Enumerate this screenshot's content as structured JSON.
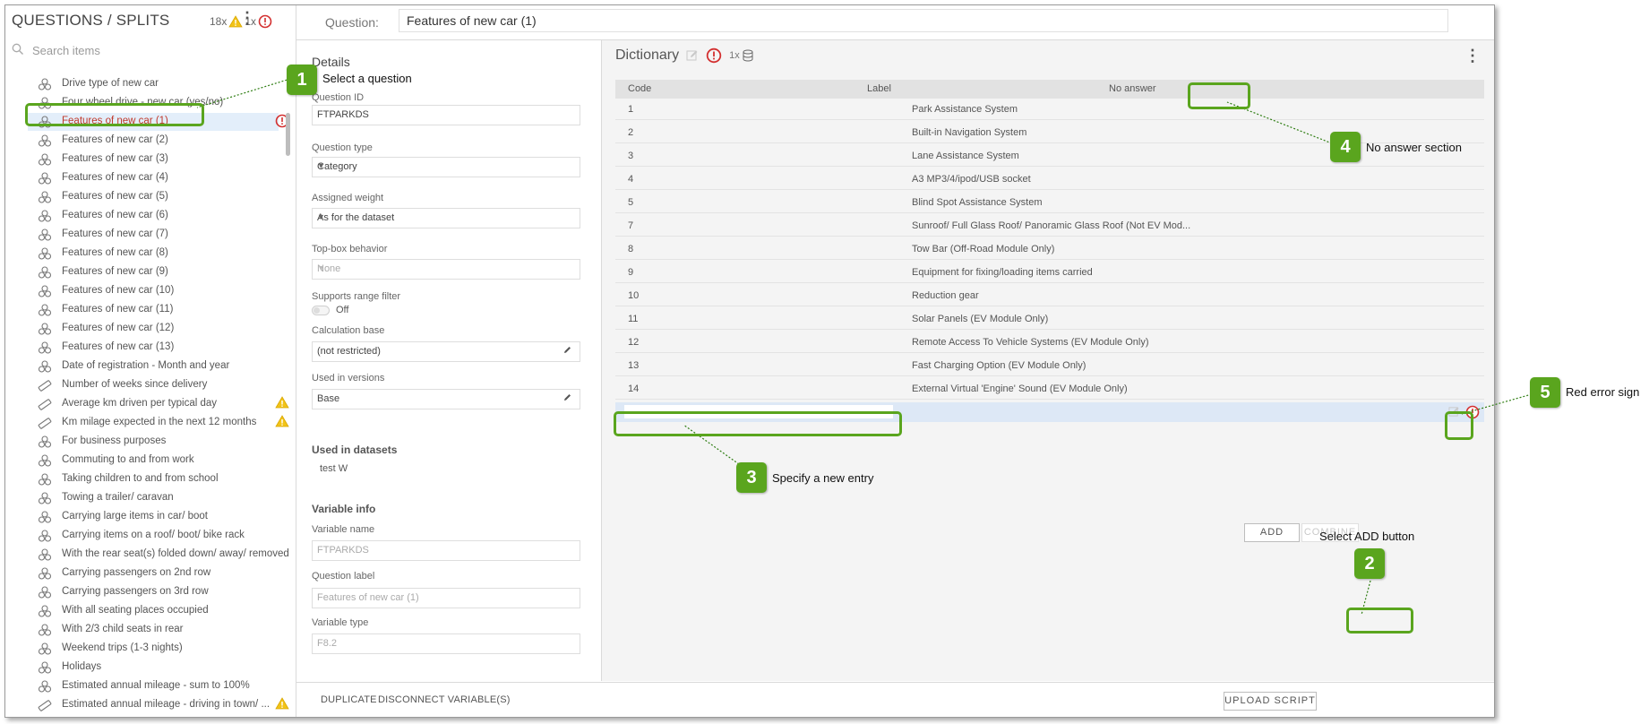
{
  "left_panel": {
    "title": "QUESTIONS / SPLITS",
    "warning_count": "18x",
    "error_count": "1x",
    "search_placeholder": "Search items",
    "items": [
      {
        "label": "Drive type of new car",
        "icon": "category-icon"
      },
      {
        "label": "Four wheel drive - new car (yes/no)",
        "icon": "category-icon"
      },
      {
        "label": "Features of new car (1)",
        "icon": "category-icon",
        "selected": true,
        "error": true
      },
      {
        "label": "Features of new car (2)",
        "icon": "category-icon"
      },
      {
        "label": "Features of new car (3)",
        "icon": "category-icon"
      },
      {
        "label": "Features of new car (4)",
        "icon": "category-icon"
      },
      {
        "label": "Features of new car (5)",
        "icon": "category-icon"
      },
      {
        "label": "Features of new car (6)",
        "icon": "category-icon"
      },
      {
        "label": "Features of new car (7)",
        "icon": "category-icon"
      },
      {
        "label": "Features of new car (8)",
        "icon": "category-icon"
      },
      {
        "label": "Features of new car (9)",
        "icon": "category-icon"
      },
      {
        "label": "Features of new car (10)",
        "icon": "category-icon"
      },
      {
        "label": "Features of new car (11)",
        "icon": "category-icon"
      },
      {
        "label": "Features of new car (12)",
        "icon": "category-icon"
      },
      {
        "label": "Features of new car (13)",
        "icon": "category-icon"
      },
      {
        "label": "Date of registration - Month and year",
        "icon": "category-icon"
      },
      {
        "label": "Number of weeks since delivery",
        "icon": "numeric-icon"
      },
      {
        "label": "Average km driven per typical day",
        "icon": "numeric-icon",
        "warning": true
      },
      {
        "label": "Km milage expected in the next 12 months",
        "icon": "numeric-icon",
        "warning": true
      },
      {
        "label": "For business purposes",
        "icon": "category-icon"
      },
      {
        "label": "Commuting to and from work",
        "icon": "category-icon"
      },
      {
        "label": "Taking children to and from school",
        "icon": "category-icon"
      },
      {
        "label": "Towing a trailer/ caravan",
        "icon": "category-icon"
      },
      {
        "label": "Carrying large items in car/ boot",
        "icon": "category-icon"
      },
      {
        "label": "Carrying items on a roof/ boot/ bike rack",
        "icon": "category-icon"
      },
      {
        "label": "With the rear seat(s) folded down/ away/ removed",
        "icon": "category-icon"
      },
      {
        "label": "Carrying passengers on 2nd row",
        "icon": "category-icon"
      },
      {
        "label": "Carrying passengers on 3rd row",
        "icon": "category-icon"
      },
      {
        "label": "With all seating places occupied",
        "icon": "category-icon"
      },
      {
        "label": "With 2/3 child seats in rear",
        "icon": "category-icon"
      },
      {
        "label": "Weekend trips (1-3 nights)",
        "icon": "category-icon"
      },
      {
        "label": "Holidays",
        "icon": "category-icon"
      },
      {
        "label": "Estimated annual mileage - sum to 100%",
        "icon": "category-icon"
      },
      {
        "label": "Estimated annual mileage - driving in town/ ...",
        "icon": "numeric-icon",
        "warning": true
      }
    ]
  },
  "question_bar": {
    "label": "Question:",
    "value": "Features of new car (1)"
  },
  "details": {
    "title": "Details",
    "question_id_label": "Question ID",
    "question_id_value": "FTPARKDS",
    "question_type_label": "Question type",
    "question_type_value": "Category",
    "assigned_weight_label": "Assigned weight",
    "assigned_weight_value": "As for the dataset",
    "topbox_label": "Top-box behavior",
    "topbox_value": "None",
    "range_filter_label": "Supports range filter",
    "range_filter_value": "Off",
    "calc_base_label": "Calculation base",
    "calc_base_value": "(not restricted)",
    "versions_label": "Used in versions",
    "versions_value": "Base",
    "datasets_title": "Used in datasets",
    "datasets_value": "test W",
    "variable_info_title": "Variable info",
    "variable_name_label": "Variable name",
    "variable_name_value": "FTPARKDS",
    "question_label_label": "Question label",
    "question_label_value": "Features of new car (1)",
    "variable_type_label": "Variable type",
    "variable_type_value": "F8.2"
  },
  "dictionary": {
    "title": "Dictionary",
    "count": "1x",
    "columns": {
      "code": "Code",
      "label": "Label",
      "no_answer": "No answer"
    },
    "rows": [
      {
        "code": "1",
        "label": "Park Assistance System"
      },
      {
        "code": "2",
        "label": "Built-in Navigation System"
      },
      {
        "code": "3",
        "label": "Lane Assistance System"
      },
      {
        "code": "4",
        "label": "A3 MP3/4/ipod/USB socket"
      },
      {
        "code": "5",
        "label": "Blind Spot Assistance System"
      },
      {
        "code": "7",
        "label": "Sunroof/ Full Glass Roof/ Panoramic Glass Roof (Not EV Mod..."
      },
      {
        "code": "8",
        "label": "Tow Bar (Off-Road Module Only)"
      },
      {
        "code": "9",
        "label": "Equipment for fixing/loading items carried"
      },
      {
        "code": "10",
        "label": "Reduction gear"
      },
      {
        "code": "11",
        "label": "Solar Panels (EV Module Only)"
      },
      {
        "code": "12",
        "label": "Remote Access To Vehicle Systems (EV Module Only)"
      },
      {
        "code": "13",
        "label": "Fast Charging Option (EV Module Only)"
      },
      {
        "code": "14",
        "label": "External Virtual 'Engine' Sound (EV Module Only)"
      }
    ],
    "add_label": "ADD",
    "combine_label": "COMBINE"
  },
  "bottom_bar": {
    "duplicate": "DUPLICATE",
    "disconnect": "DISCONNECT VARIABLE(S)",
    "upload": "UPLOAD SCRIPT"
  },
  "callouts": [
    {
      "number": "1",
      "text": "Select a question"
    },
    {
      "number": "2",
      "text": "Select ADD button"
    },
    {
      "number": "3",
      "text": "Specify a new entry"
    },
    {
      "number": "4",
      "text": "No answer section"
    },
    {
      "number": "5",
      "text": "Red error sign"
    }
  ],
  "colors": {
    "accent_green": "#5aa51e",
    "error_red": "#d32f2f",
    "warning_yellow": "#f2c318",
    "selection_blue": "#e3eefa"
  }
}
